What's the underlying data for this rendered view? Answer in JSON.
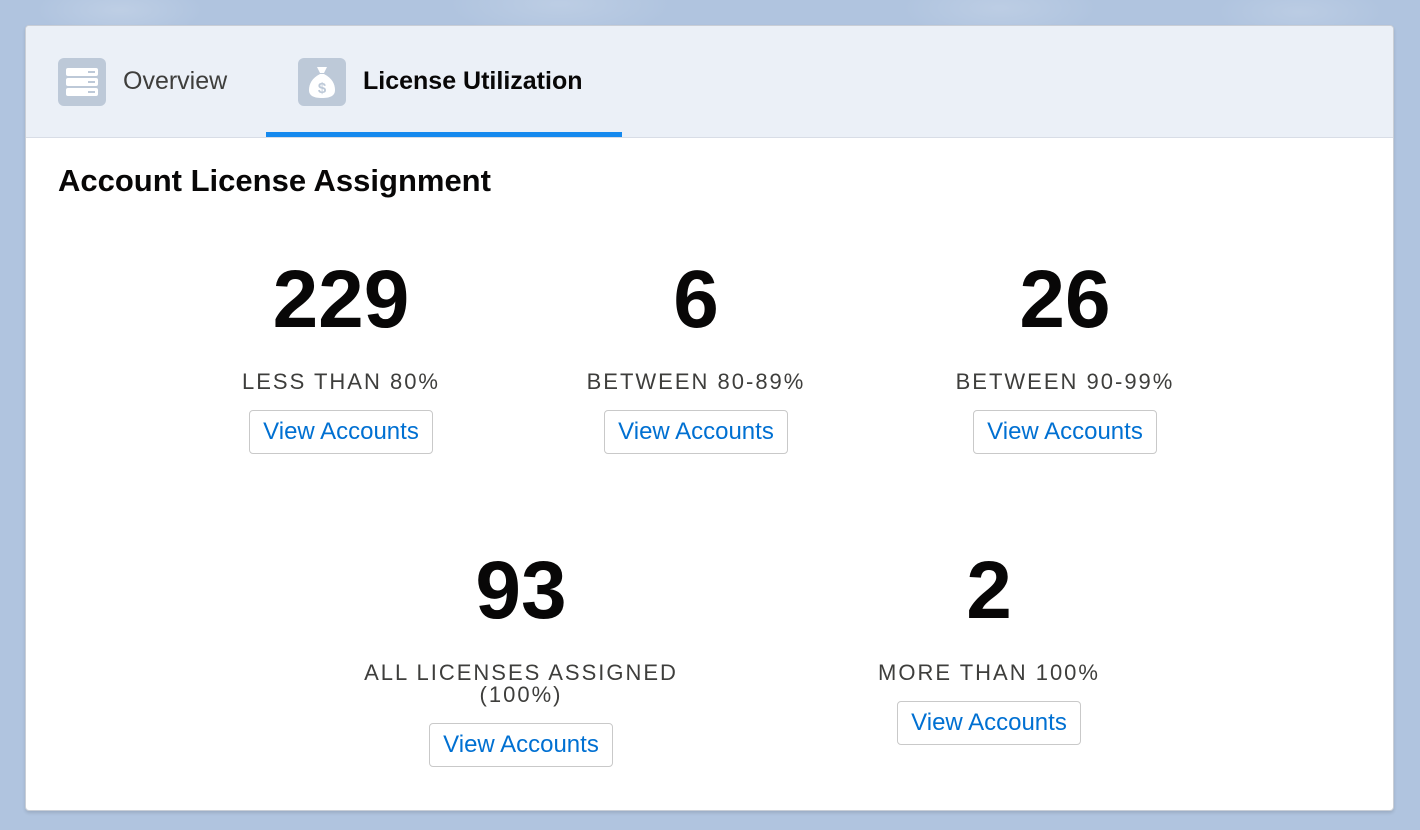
{
  "tabs": {
    "overview": {
      "label": "Overview",
      "icon": "list-icon"
    },
    "license_utilization": {
      "label": "License Utilization",
      "icon": "money-bag-icon",
      "active": true
    }
  },
  "section": {
    "title": "Account License Assignment"
  },
  "metrics": [
    {
      "value": "229",
      "label": "LESS THAN 80%",
      "button": "View Accounts"
    },
    {
      "value": "6",
      "label": "BETWEEN 80-89%",
      "button": "View Accounts"
    },
    {
      "value": "26",
      "label": "BETWEEN 90-99%",
      "button": "View Accounts"
    },
    {
      "value": "93",
      "label": "ALL LICENSES ASSIGNED (100%)",
      "button": "View Accounts"
    },
    {
      "value": "2",
      "label": "MORE THAN 100%",
      "button": "View Accounts"
    }
  ],
  "colors": {
    "accent": "#1589ee",
    "link": "#0070d2",
    "background": "#b0c4df"
  }
}
